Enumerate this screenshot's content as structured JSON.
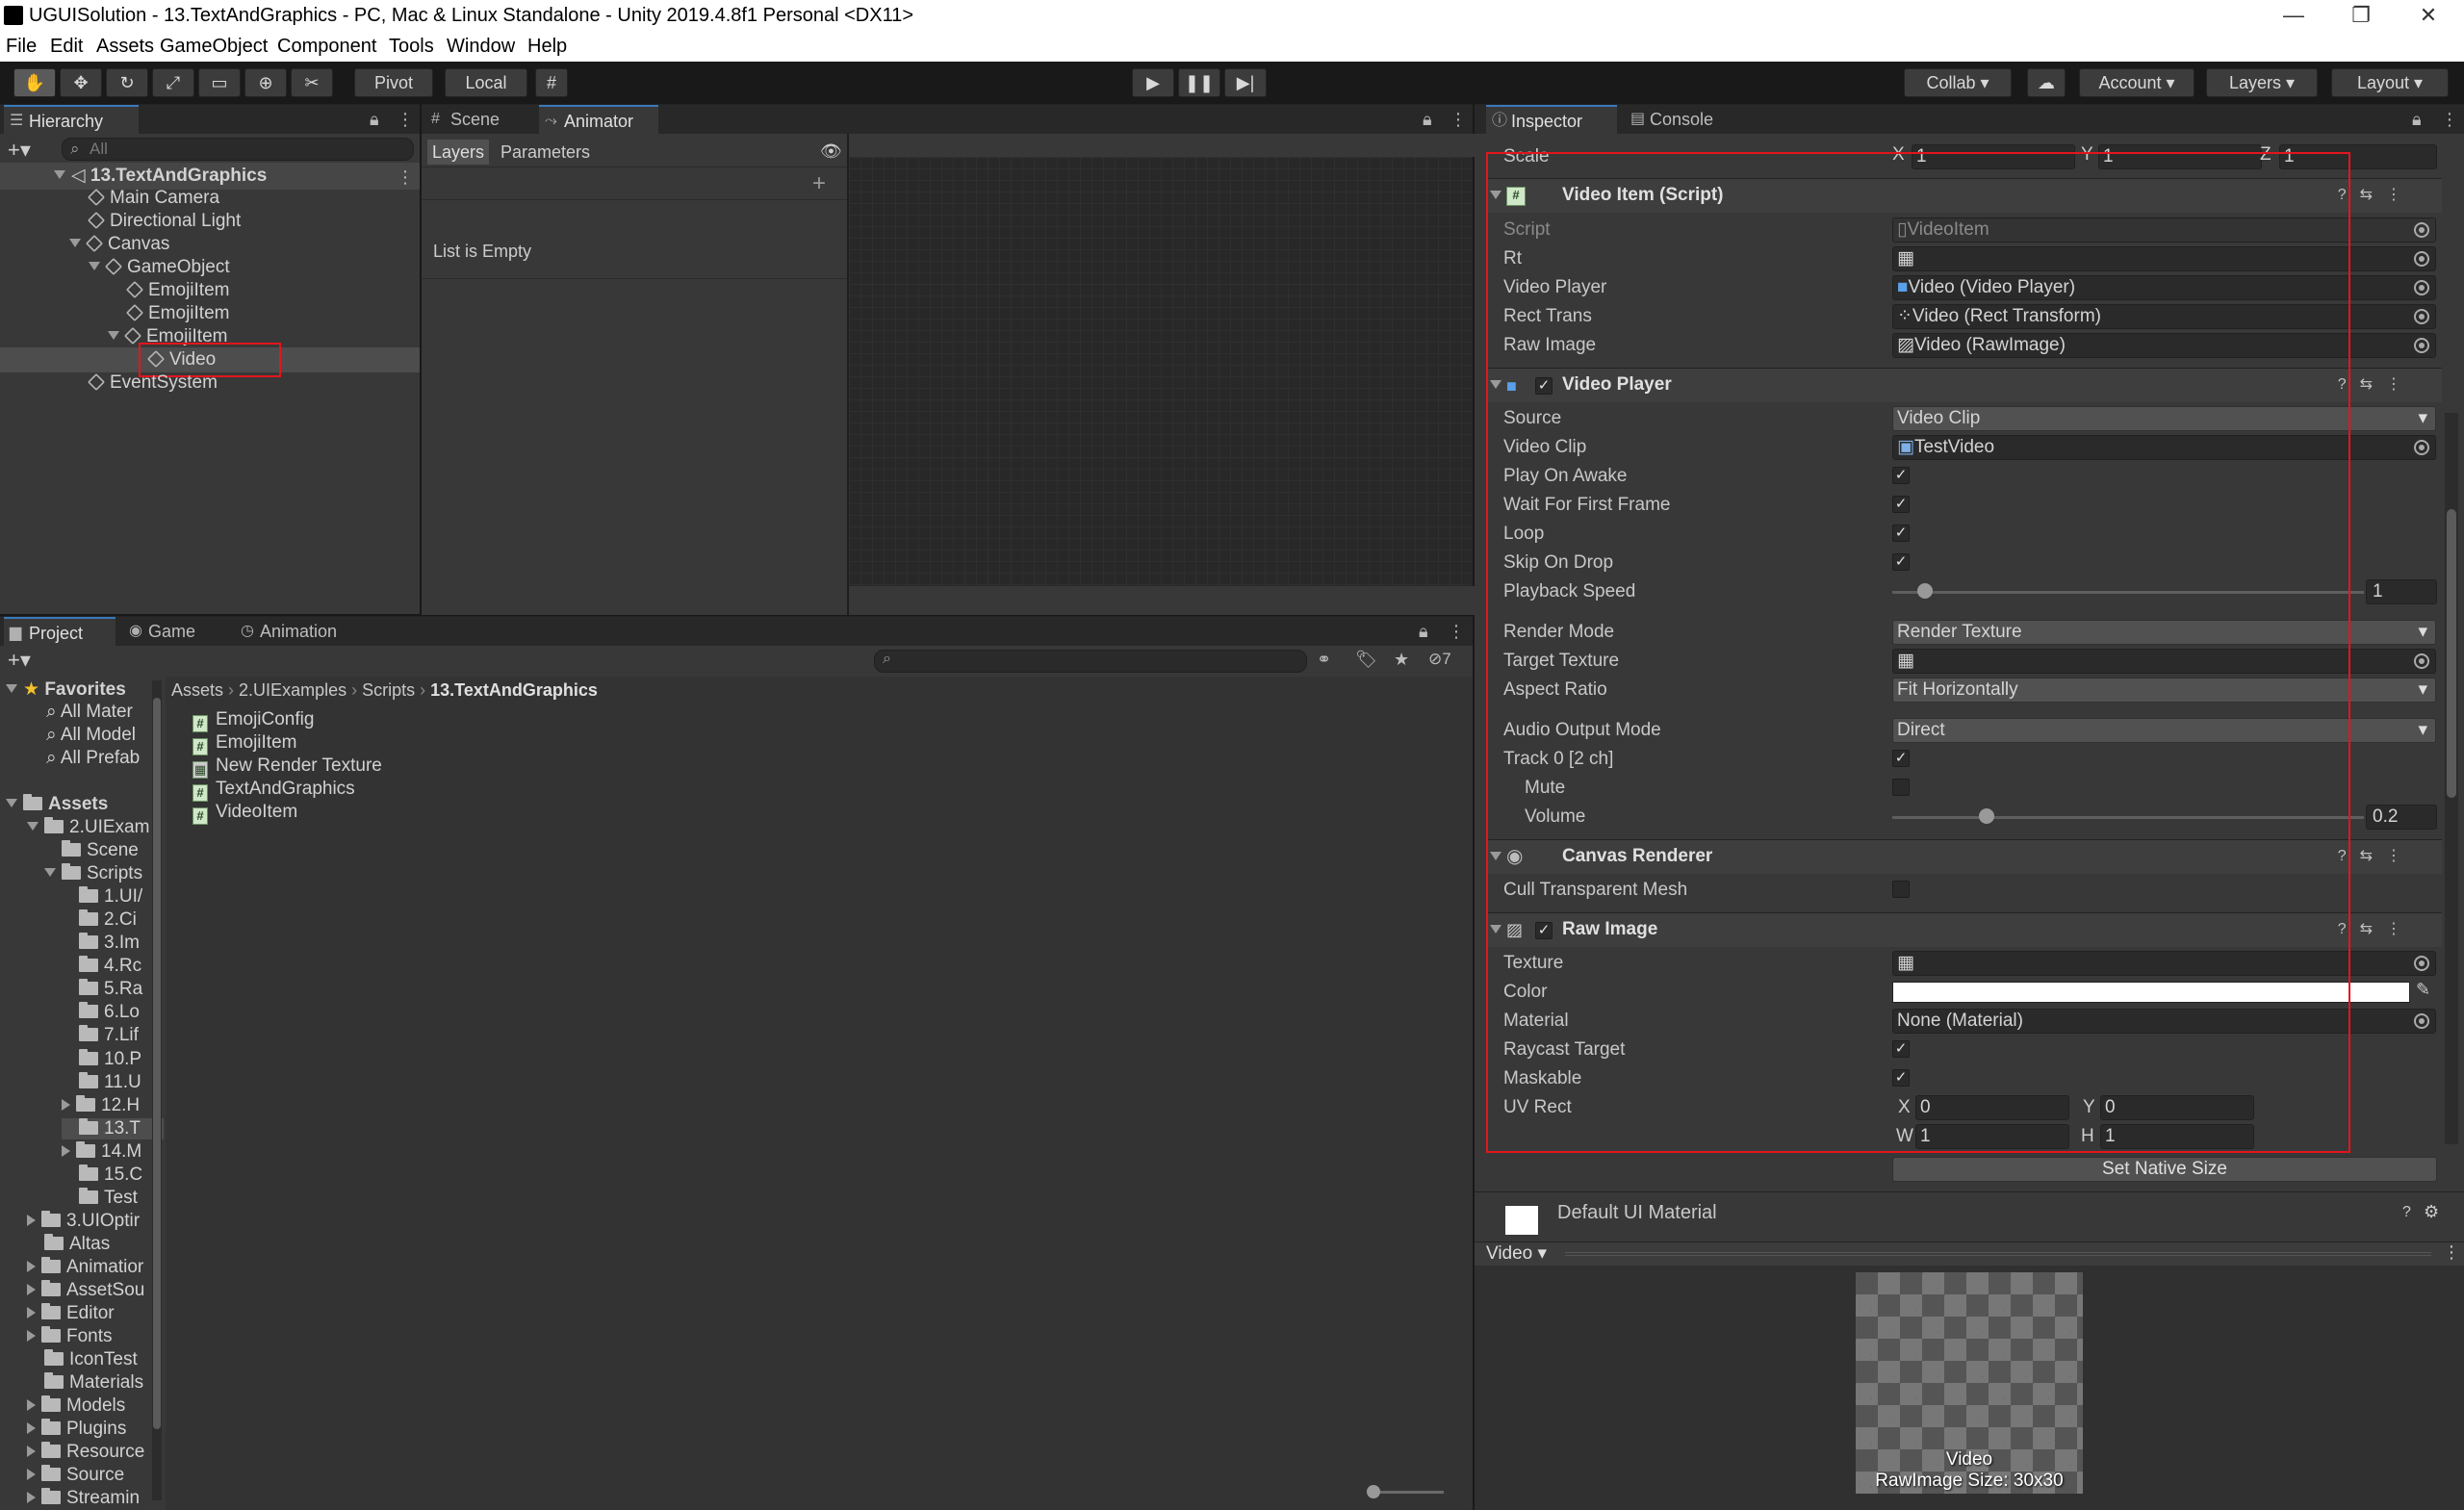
{
  "window": {
    "title": "UGUISolution - 13.TextAndGraphics - PC, Mac & Linux Standalone - Unity 2019.4.8f1 Personal <DX11>",
    "controls": [
      "—",
      "❐",
      "✕"
    ]
  },
  "menu": [
    "File",
    "Edit",
    "Assets",
    "GameObject",
    "Component",
    "Tools",
    "Window",
    "Help"
  ],
  "toolbar": {
    "pivot": "Pivot",
    "local": "Local",
    "collab": "Collab ▾",
    "account": "Account",
    "layers": "Layers",
    "layout": "Layout",
    "play_icon": "play-icon",
    "pause_icon": "pause-icon",
    "step_icon": "step-icon"
  },
  "hierarchy": {
    "tab": "Hierarchy",
    "search_placeholder": "All",
    "scene": "13.TextAndGraphics",
    "items": [
      "Main Camera",
      "Directional Light",
      "Canvas",
      "GameObject",
      "EmojiItem",
      "EmojiItem",
      "EmojiItem",
      "Video",
      "EventSystem"
    ]
  },
  "scene_tabs": {
    "scene": "Scene",
    "animator": "Animator"
  },
  "animator": {
    "layers": "Layers",
    "parameters": "Parameters",
    "empty": "List is Empty"
  },
  "inspector_tabs": {
    "inspector": "Inspector",
    "console": "Console"
  },
  "transform": {
    "scale_label": "Scale",
    "x_label": "X",
    "x": "1",
    "y_label": "Y",
    "y": "1",
    "z_label": "Z",
    "z": "1"
  },
  "video_item": {
    "title": "Video Item (Script)",
    "rows": [
      {
        "label": "Script",
        "value": "VideoItem"
      },
      {
        "label": "Rt",
        "value": ""
      },
      {
        "label": "Video Player",
        "value": "Video (Video Player)"
      },
      {
        "label": "Rect Trans",
        "value": "Video (Rect Transform)"
      },
      {
        "label": "Raw Image",
        "value": "Video (RawImage)"
      }
    ]
  },
  "video_player": {
    "title": "Video Player",
    "source_label": "Source",
    "source": "Video Clip",
    "clip_label": "Video Clip",
    "clip": "TestVideo",
    "play_on_awake": "Play On Awake",
    "wait_first": "Wait For First Frame",
    "loop": "Loop",
    "skip_drop": "Skip On Drop",
    "speed_label": "Playback Speed",
    "speed": "1",
    "speed_fraction": 0.07,
    "render_mode_label": "Render Mode",
    "render_mode": "Render Texture",
    "target_tex_label": "Target Texture",
    "target_tex": "",
    "aspect_label": "Aspect Ratio",
    "aspect": "Fit Horizontally",
    "audio_mode_label": "Audio Output Mode",
    "audio_mode": "Direct",
    "track_label": "Track 0 [2 ch]",
    "mute_label": "Mute",
    "volume_label": "Volume",
    "volume": "0.2",
    "volume_fraction": 0.2
  },
  "canvas_renderer": {
    "title": "Canvas Renderer",
    "cull_label": "Cull Transparent Mesh"
  },
  "raw_image": {
    "title": "Raw Image",
    "texture_label": "Texture",
    "color_label": "Color",
    "color_value": "#ffffff",
    "material_label": "Material",
    "material": "None (Material)",
    "raycast_label": "Raycast Target",
    "maskable_label": "Maskable",
    "uv_label": "UV Rect",
    "uv_x_label": "X",
    "uv_x": "0",
    "uv_y_label": "Y",
    "uv_y": "0",
    "uv_w_label": "W",
    "uv_w": "1",
    "uv_h_label": "H",
    "uv_h": "1",
    "native_btn": "Set Native Size"
  },
  "material": {
    "name": "Default UI Material"
  },
  "preview": {
    "dropdown": "Video ▾",
    "caption1": "Video",
    "caption2": "RawImage Size: 30x30"
  },
  "project": {
    "tabs": {
      "project": "Project",
      "game": "Game",
      "animation": "Animation"
    },
    "hidden_count": "7",
    "favorites_label": "Favorites",
    "favorites": [
      "All Mater",
      "All Model",
      "All Prefab"
    ],
    "assets_label": "Assets",
    "tree": [
      "2.UIExam",
      "Scene",
      "Scripts",
      "1.UI/",
      "2.Ci",
      "3.Im",
      "4.Rc",
      "5.Ra",
      "6.Lo",
      "7.Lif",
      "10.P",
      "11.U",
      "12.H",
      "13.T",
      "14.M",
      "15.C",
      "Test",
      "3.UIOptir",
      "Altas",
      "Animatior",
      "AssetSou",
      "Editor",
      "Fonts",
      "IconTest",
      "Materials",
      "Models",
      "Plugins",
      "Resource",
      "Source",
      "Streamin"
    ],
    "breadcrumb": [
      "Assets",
      "2.UIExamples",
      "Scripts",
      "13.TextAndGraphics"
    ],
    "files": [
      "EmojiConfig",
      "EmojiItem",
      "New Render Texture",
      "TextAndGraphics",
      "VideoItem"
    ]
  },
  "colors": {
    "highlight": "#e3151d",
    "accent": "#3a79bb"
  }
}
